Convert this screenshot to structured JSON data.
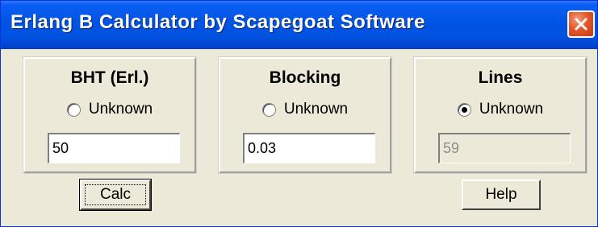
{
  "window": {
    "title": "Erlang B Calculator by Scapegoat Software"
  },
  "groups": [
    {
      "title": "BHT (Erl.)",
      "radio_label": "Unknown",
      "selected": false,
      "value": "50",
      "disabled": false
    },
    {
      "title": "Blocking",
      "radio_label": "Unknown",
      "selected": false,
      "value": "0.03",
      "disabled": false
    },
    {
      "title": "Lines",
      "radio_label": "Unknown",
      "selected": true,
      "value": "59",
      "disabled": true
    }
  ],
  "buttons": {
    "calc_label": "Calc",
    "help_label": "Help"
  },
  "icons": {
    "close": "close-icon"
  },
  "colors": {
    "titlebar": "#0054e3",
    "close_button": "#e4572a",
    "face": "#ece9d8"
  }
}
